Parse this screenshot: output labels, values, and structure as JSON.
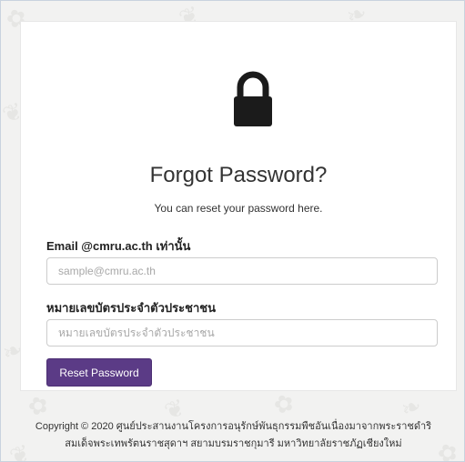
{
  "page": {
    "title": "Forgot Password?",
    "subtitle": "You can reset your password here.",
    "lock_icon": "lock-icon"
  },
  "form": {
    "email_label": "Email @cmru.ac.th เท่านั้น",
    "email_placeholder": "sample@cmru.ac.th",
    "email_value": "",
    "idcard_label": "หมายเลขบัตรประจำตัวประชาชน",
    "idcard_placeholder": "หมายเลขบัตรประจำตัวประชาชน",
    "idcard_value": "",
    "submit_label": "Reset Password"
  },
  "footer": {
    "line1": "Copyright © 2020 ศูนย์ประสานงานโครงการอนุรักษ์พันธุกรรมพืชอันเนื่องมาจากพระราชดำริ",
    "line2": "สมเด็จพระเทพรัตนราชสุดาฯ สยามบรมราชกุมารี มหาวิทยาลัยราชภัฏเชียงใหม่"
  },
  "colors": {
    "button": "#5b3b86",
    "background": "#f2f2f1",
    "card": "#ffffff"
  }
}
